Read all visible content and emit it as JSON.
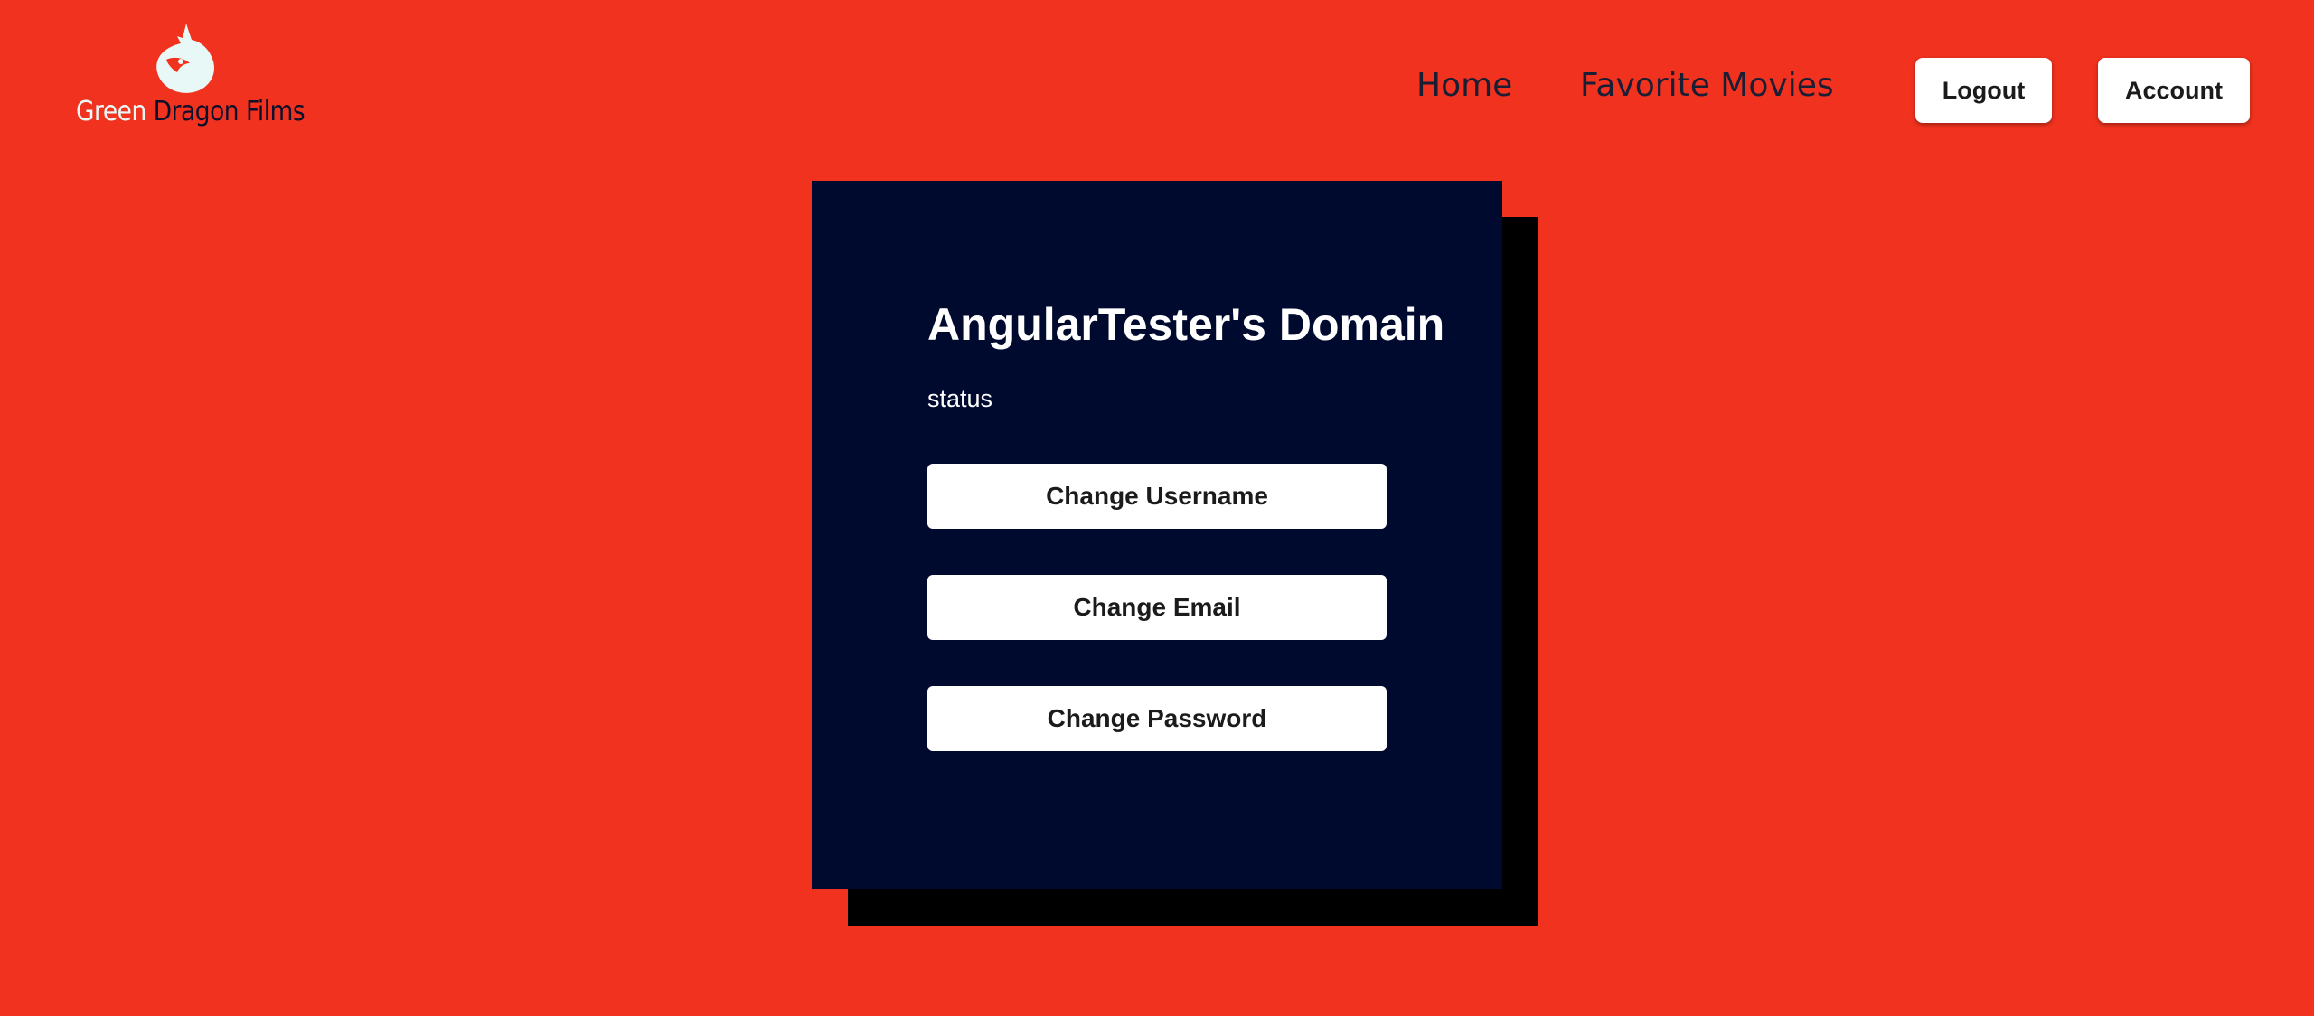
{
  "brand": {
    "logo_word_1": "Green",
    "logo_word_2": "Dragon Films",
    "logo_icon": "dragon-icon",
    "logo_color": "#e7f8f6"
  },
  "nav": {
    "home_label": "Home",
    "favorites_label": "Favorite Movies",
    "logout_label": "Logout",
    "account_label": "Account"
  },
  "profile": {
    "title": "AngularTester's Domain",
    "status": "status",
    "change_username_label": "Change Username",
    "change_email_label": "Change Email",
    "change_password_label": "Change Password"
  },
  "colors": {
    "background": "#f0321e",
    "card": "#000a2f",
    "card_shadow": "#000000",
    "button": "#ffffff"
  }
}
